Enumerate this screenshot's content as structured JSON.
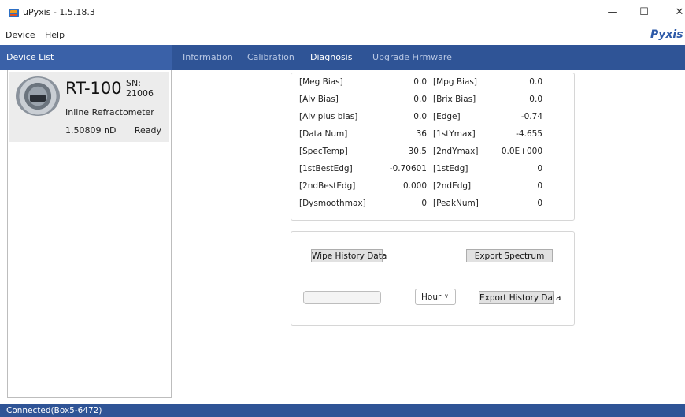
{
  "window": {
    "title": "uPyxis - 1.5.18.3",
    "controls": {
      "minimize": "—",
      "maximize": "☐",
      "close": "✕"
    },
    "brand": "Pyxis"
  },
  "menu": {
    "items": [
      "Device",
      "Help"
    ]
  },
  "nav": {
    "device_list_label": "Device List",
    "tabs": [
      "Information",
      "Calibration",
      "Diagnosis",
      "Upgrade Firmware"
    ],
    "active_tab": "Diagnosis"
  },
  "device": {
    "model": "RT-100",
    "serial": "SN: 21006",
    "type": "Inline Refractometer",
    "reading": "1.50809  nD",
    "status": "Ready"
  },
  "diagnosis": {
    "rows": [
      {
        "l1": "[Meg Bias]",
        "v1": "0.0",
        "l2": "[Mpg Bias]",
        "v2": "0.0"
      },
      {
        "l1": "[Alv Bias]",
        "v1": "0.0",
        "l2": "[Brix Bias]",
        "v2": "0.0"
      },
      {
        "l1": "[Alv plus bias]",
        "v1": "0.0",
        "l2": "[Edge]",
        "v2": "-0.74"
      },
      {
        "l1": "[Data Num]",
        "v1": "36",
        "l2": "[1stYmax]",
        "v2": "-4.655"
      },
      {
        "l1": "[SpecTemp]",
        "v1": "30.5",
        "l2": "[2ndYmax]",
        "v2": "0.0E+000"
      },
      {
        "l1": "[1stBestEdg]",
        "v1": "-0.70601",
        "l2": "[1stEdg]",
        "v2": "0"
      },
      {
        "l1": "[2ndBestEdg]",
        "v1": "0.000",
        "l2": "[2ndEdg]",
        "v2": "0"
      },
      {
        "l1": "[Dysmoothmax]",
        "v1": "0",
        "l2": "[PeakNum]",
        "v2": "0"
      }
    ]
  },
  "export": {
    "wipe_label": "Wipe History Data",
    "export_spectrum_label": "Export Spectrum",
    "period_value": "Hour",
    "export_history_label": "Export History Data",
    "date_value": ""
  },
  "status_bar": {
    "text": "Connected(Box5-6472)"
  },
  "colors": {
    "nav_bar": "#2f5496",
    "device_list_header": "#3a61a8",
    "card_bg": "#ececec"
  }
}
